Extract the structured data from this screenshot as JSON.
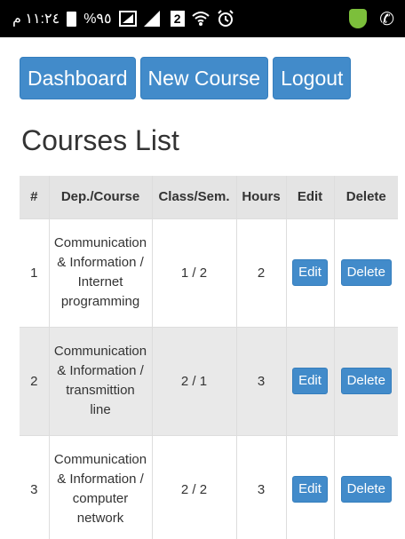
{
  "status_bar": {
    "time": "١١:٢٤ م",
    "battery": "%٩٥",
    "network_badge": "2",
    "icons": [
      "battery-icon",
      "signal-box-icon",
      "signal-icon",
      "sim-2-icon",
      "wifi-icon",
      "alarm-icon",
      "security-shield-icon",
      "phone-call-icon"
    ]
  },
  "nav": {
    "dashboard_label": "Dashboard",
    "new_course_label": "New Course",
    "logout_label": "Logout"
  },
  "page": {
    "title": "Courses List"
  },
  "table": {
    "headers": [
      "#",
      "Dep./Course",
      "Class/Sem.",
      "Hours",
      "Edit",
      "Delete"
    ],
    "rows": [
      {
        "num": "1",
        "course_lines": [
          "Communication",
          "& Information /",
          "Internet",
          "programming"
        ],
        "class_sem": "1 / 2",
        "hours": "2",
        "edit": "Edit",
        "delete": "Delete"
      },
      {
        "num": "2",
        "course_lines": [
          "Communication",
          "& Information /",
          "transmittion",
          "line"
        ],
        "class_sem": "2 / 1",
        "hours": "3",
        "edit": "Edit",
        "delete": "Delete"
      },
      {
        "num": "3",
        "course_lines": [
          "Communication",
          "& Information /",
          "computer",
          "network"
        ],
        "class_sem": "2 / 2",
        "hours": "3",
        "edit": "Edit",
        "delete": "Delete"
      }
    ]
  },
  "colors": {
    "primary": "#428bca",
    "header_bg": "#e4e4e4",
    "stripe_bg": "#e9e9e9",
    "status_bar": "#000000"
  }
}
